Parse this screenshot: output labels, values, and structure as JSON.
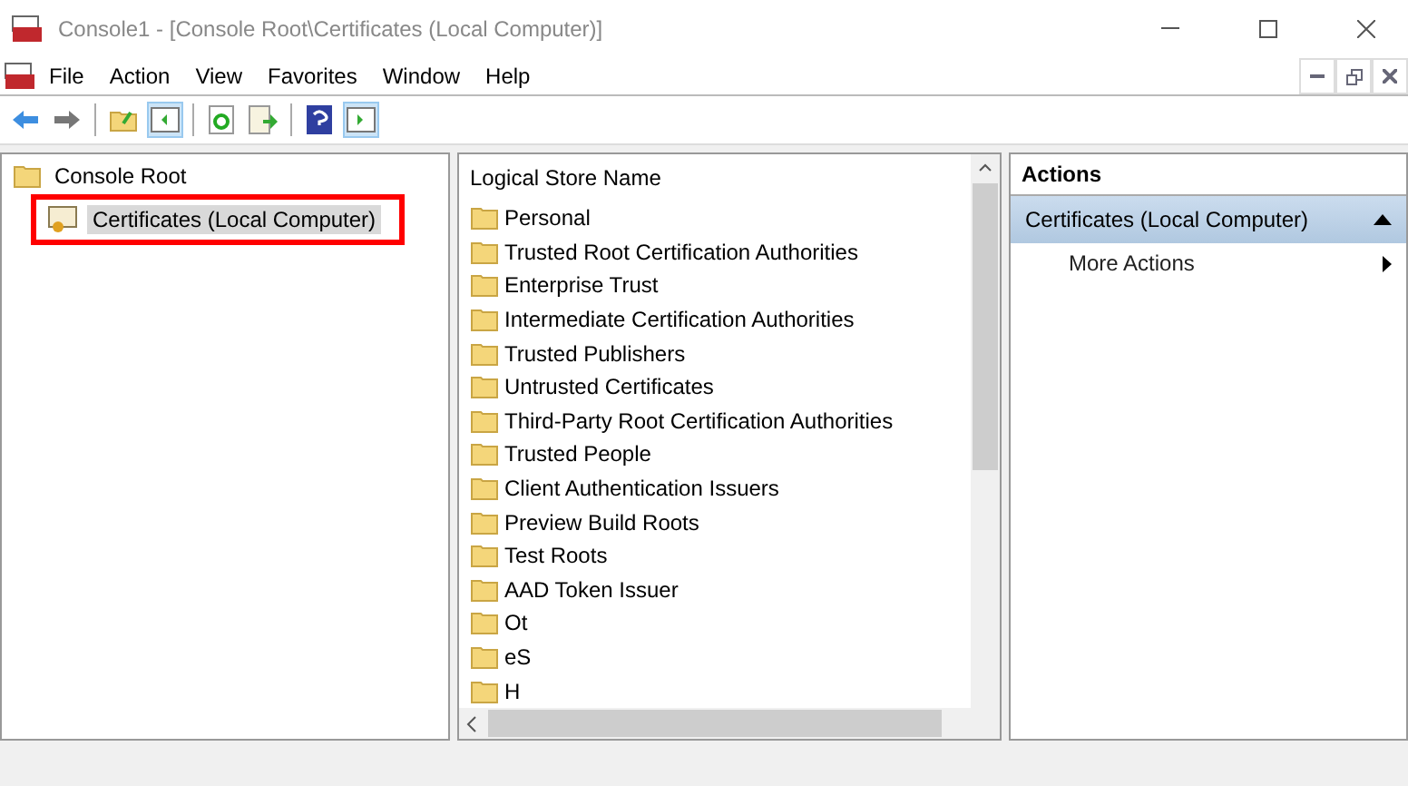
{
  "window": {
    "title": "Console1 - [Console Root\\Certificates (Local Computer)]"
  },
  "menu": [
    "File",
    "Action",
    "View",
    "Favorites",
    "Window",
    "Help"
  ],
  "toolbar": [
    {
      "kind": "back"
    },
    {
      "kind": "forward"
    },
    {
      "kind": "separator"
    },
    {
      "kind": "up"
    },
    {
      "kind": "tree",
      "pressed": true
    },
    {
      "kind": "separator"
    },
    {
      "kind": "refresh"
    },
    {
      "kind": "export"
    },
    {
      "kind": "separator"
    },
    {
      "kind": "help"
    },
    {
      "kind": "actions",
      "pressed": true
    }
  ],
  "tree": [
    {
      "label": "Console Root",
      "children": [
        {
          "label": "Certificates (Local Computer)",
          "selected": true,
          "outlined": true
        }
      ]
    }
  ],
  "list": {
    "column": "Logical Store Name",
    "items": [
      "Personal",
      "Trusted Root Certification Authorities",
      "Enterprise Trust",
      "Intermediate Certification Authorities",
      "Trusted Publishers",
      "Untrusted Certificates",
      "Third-Party Root Certification Authorities",
      "Trusted People",
      "Client Authentication Issuers",
      "Preview Build Roots",
      "Test Roots",
      "AAD Token Issuer",
      "Ot",
      "eS",
      "H"
    ]
  },
  "actions": {
    "header": "Actions",
    "sections": [
      {
        "title": "Certificates (Local Computer)",
        "expanded": true,
        "items": [
          {
            "label": "More Actions",
            "kind": "submenu"
          }
        ]
      }
    ]
  }
}
